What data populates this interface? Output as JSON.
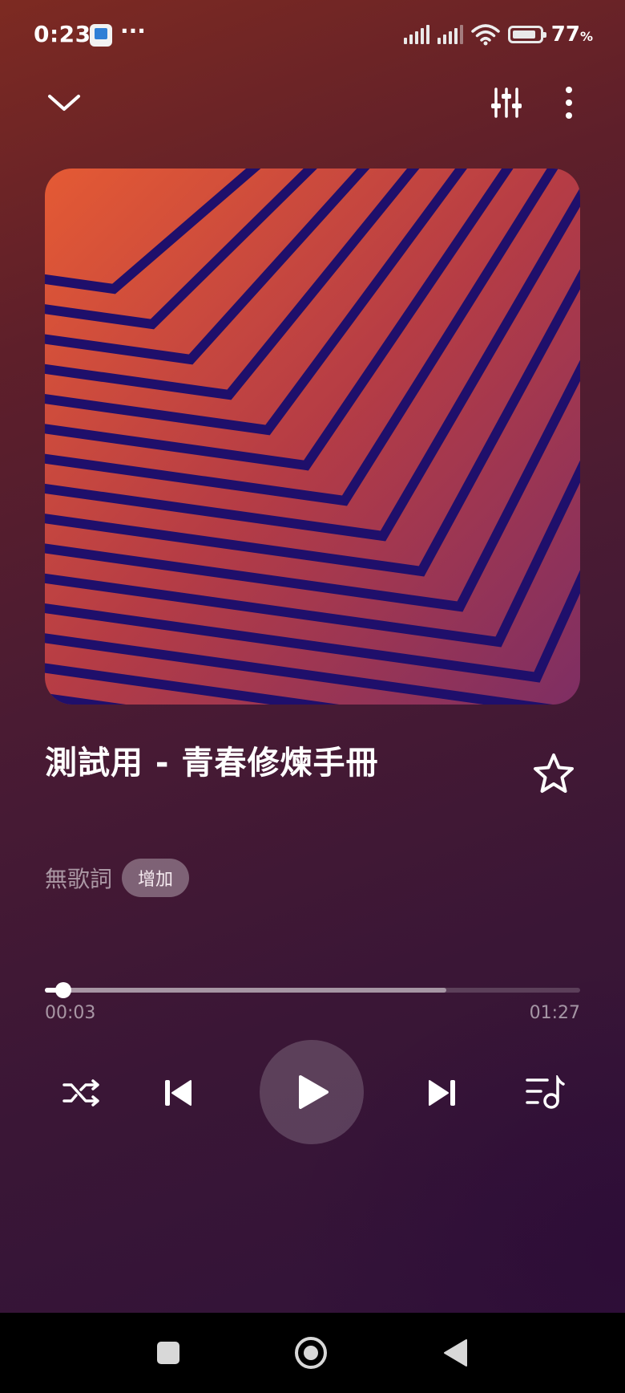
{
  "status_bar": {
    "time": "0:23",
    "more": "···",
    "battery_percent": "77",
    "battery_unit": "%"
  },
  "track": {
    "title": "測試用 - 青春修煉手冊",
    "favorited": false
  },
  "lyrics": {
    "label": "無歌詞",
    "add_button": "增加"
  },
  "playback": {
    "current_time": "00:03",
    "total_time": "01:27",
    "played_fraction": 0.034,
    "buffered_fraction": 0.75,
    "state": "paused"
  },
  "icons": {
    "collapse": "chevron-down-icon",
    "equalizer": "equalizer-icon",
    "menu": "more-vertical-icon",
    "favorite": "star-icon",
    "shuffle": "shuffle-icon",
    "previous": "skip-previous-icon",
    "play": "play-icon",
    "next": "skip-next-icon",
    "queue": "playlist-icon"
  },
  "colors": {
    "art_orange": "#e45a34",
    "art_purple": "#7e2e63",
    "art_stripe": "#1f0f6b",
    "background_top": "#7d2a22",
    "background_bottom": "#2f1239"
  }
}
